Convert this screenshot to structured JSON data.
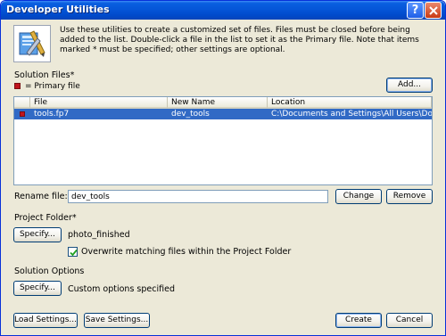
{
  "window": {
    "title": "Developer Utilities",
    "help_glyph": "?"
  },
  "intro_text": "Use these utilities to create a customized set of files. Files must be closed before being added to the list. Double-click a file in the list to set it as the Primary file. Note that items marked * must be specified; other settings are optional.",
  "solution_files": {
    "label": "Solution Files*",
    "legend": "= Primary file",
    "add_button": "Add...",
    "columns": [
      "File",
      "New Name",
      "Location"
    ],
    "rows": [
      {
        "file": "tools.fp7",
        "new_name": "dev_tools",
        "location": "C:\\Documents and Settings\\All Users\\Documents\\Que\\...",
        "primary": true,
        "selected": true
      }
    ]
  },
  "rename": {
    "label": "Rename file:",
    "value": "dev_tools",
    "change_button": "Change",
    "remove_button": "Remove"
  },
  "project_folder": {
    "label": "Project Folder*",
    "specify_button": "Specify...",
    "value": "photo_finished",
    "overwrite_label": "Overwrite matching files within the Project Folder",
    "overwrite_checked": true
  },
  "solution_options": {
    "label": "Solution Options",
    "specify_button": "Specify...",
    "value": "Custom options specified"
  },
  "footer": {
    "load_button": "Load Settings...",
    "save_button": "Save Settings...",
    "create_button": "Create",
    "cancel_button": "Cancel"
  },
  "colors": {
    "titlebar": "#0556d8",
    "selection": "#316ac5",
    "primary_marker": "#c0141c",
    "dialog_bg": "#ece9d8"
  },
  "icons": {
    "header": "developer-tools-icon",
    "close": "close-icon",
    "help": "help-icon",
    "check": "checkmark-icon"
  }
}
